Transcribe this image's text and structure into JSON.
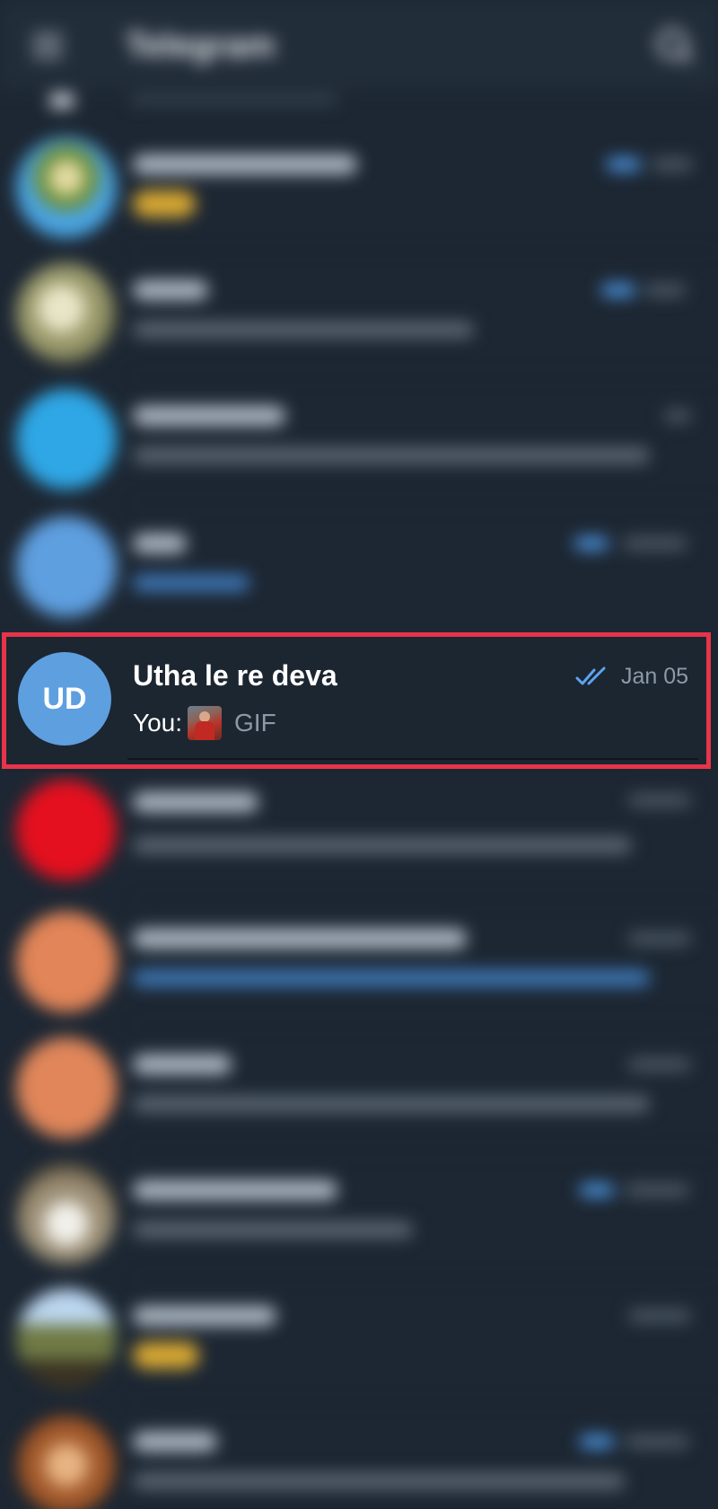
{
  "header": {
    "title": "Telegram",
    "menu_icon": "hamburger-menu-icon",
    "search_icon": "search-icon"
  },
  "highlighted_chat": {
    "avatar_initials": "UD",
    "avatar_color": "#5e9fe0",
    "name": "Utha le re deva",
    "time": "Jan 05",
    "read_status_icon": "double-check-icon",
    "message_sender": "You:",
    "message_thumbnail": "gif-thumbnail",
    "message_text": "GIF",
    "highlight_color": "#e8344a"
  },
  "colors": {
    "background": "#1d2733",
    "accent": "#4f9ae8",
    "muted_text": "#8d9aa6"
  }
}
